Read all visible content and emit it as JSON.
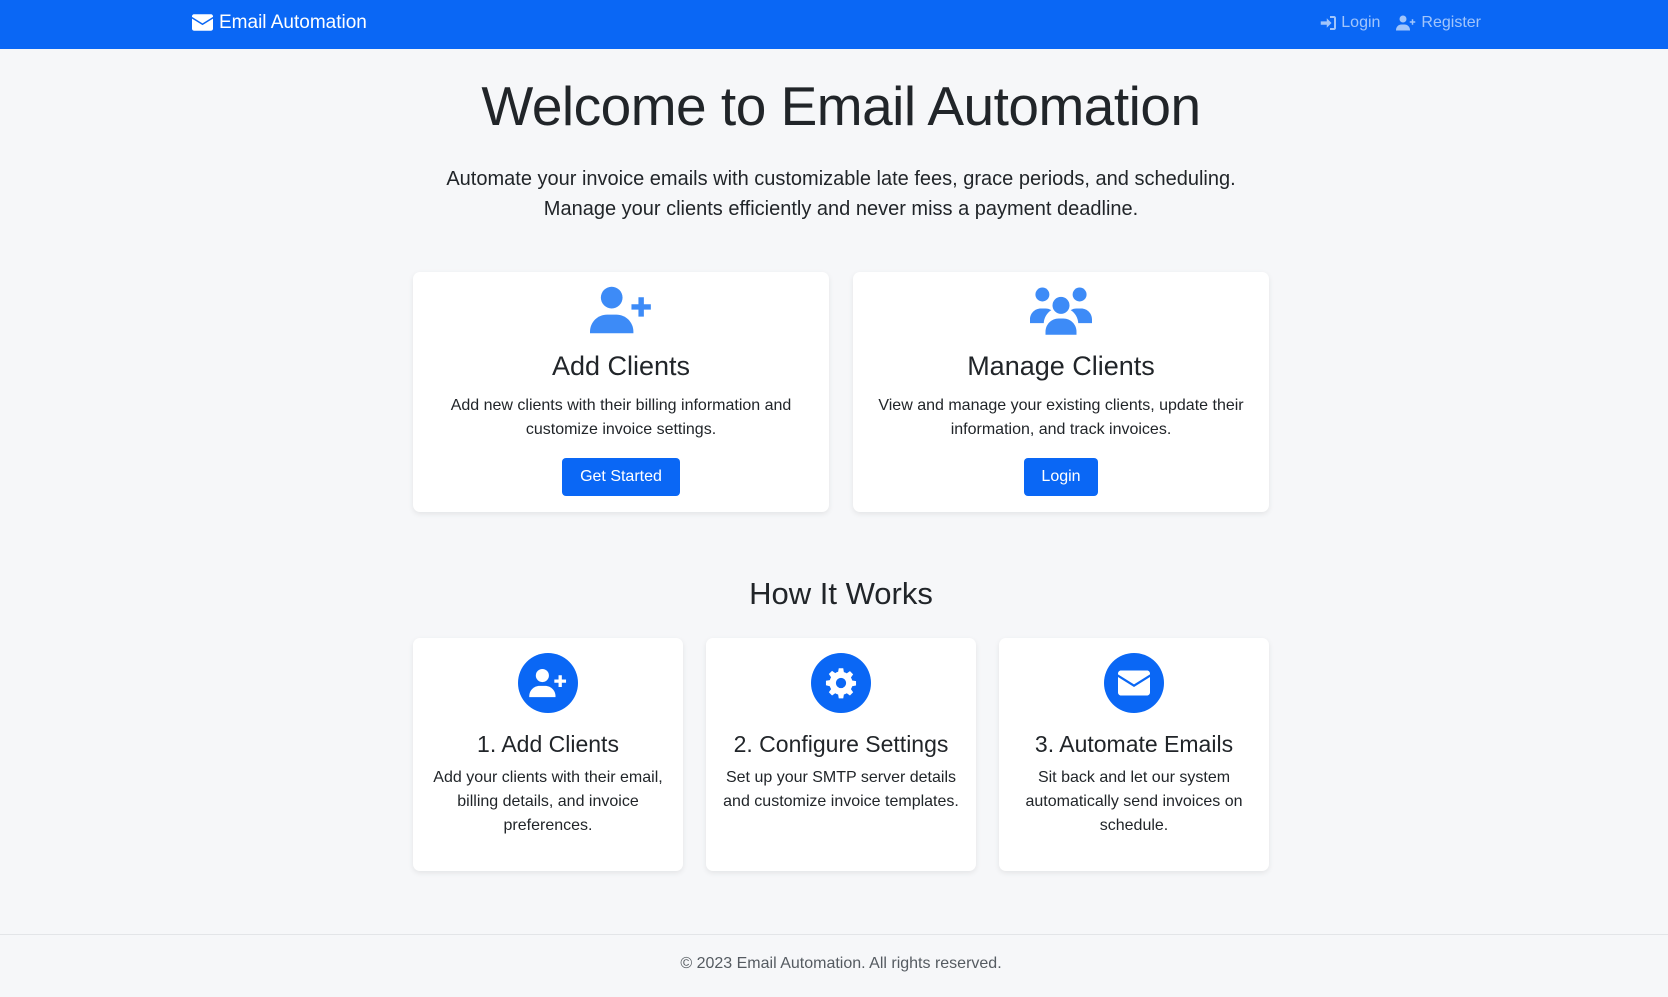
{
  "navbar": {
    "brand": "Email Automation",
    "brand_icon": "envelope-icon",
    "links": [
      {
        "label": "Login",
        "icon": "sign-in-icon"
      },
      {
        "label": "Register",
        "icon": "user-plus-icon"
      }
    ]
  },
  "hero": {
    "title": "Welcome to Email Automation",
    "lead": "Automate your invoice emails with customizable late fees, grace periods, and scheduling. Manage your clients efficiently and never miss a payment deadline."
  },
  "feature_cards": [
    {
      "icon": "user-plus-icon",
      "title": "Add Clients",
      "text": "Add new clients with their billing information and customize invoice settings.",
      "button": "Get Started"
    },
    {
      "icon": "users-icon",
      "title": "Manage Clients",
      "text": "View and manage your existing clients, update their information, and track invoices.",
      "button": "Login"
    }
  ],
  "how_it_works": {
    "title": "How It Works",
    "steps": [
      {
        "icon": "user-plus-icon",
        "title": "1. Add Clients",
        "text": "Add your clients with their email, billing details, and invoice preferences."
      },
      {
        "icon": "gear-icon",
        "title": "2. Configure Settings",
        "text": "Set up your SMTP server details and customize invoice templates."
      },
      {
        "icon": "envelope-icon",
        "title": "3. Automate Emails",
        "text": "Sit back and let our system automatically send invoices on schedule."
      }
    ]
  },
  "footer": {
    "text": "© 2023 Email Automation. All rights reserved."
  },
  "colors": {
    "primary": "#0a67f5",
    "icon_light": "#3d8bf7",
    "background": "#f6f7f9"
  }
}
